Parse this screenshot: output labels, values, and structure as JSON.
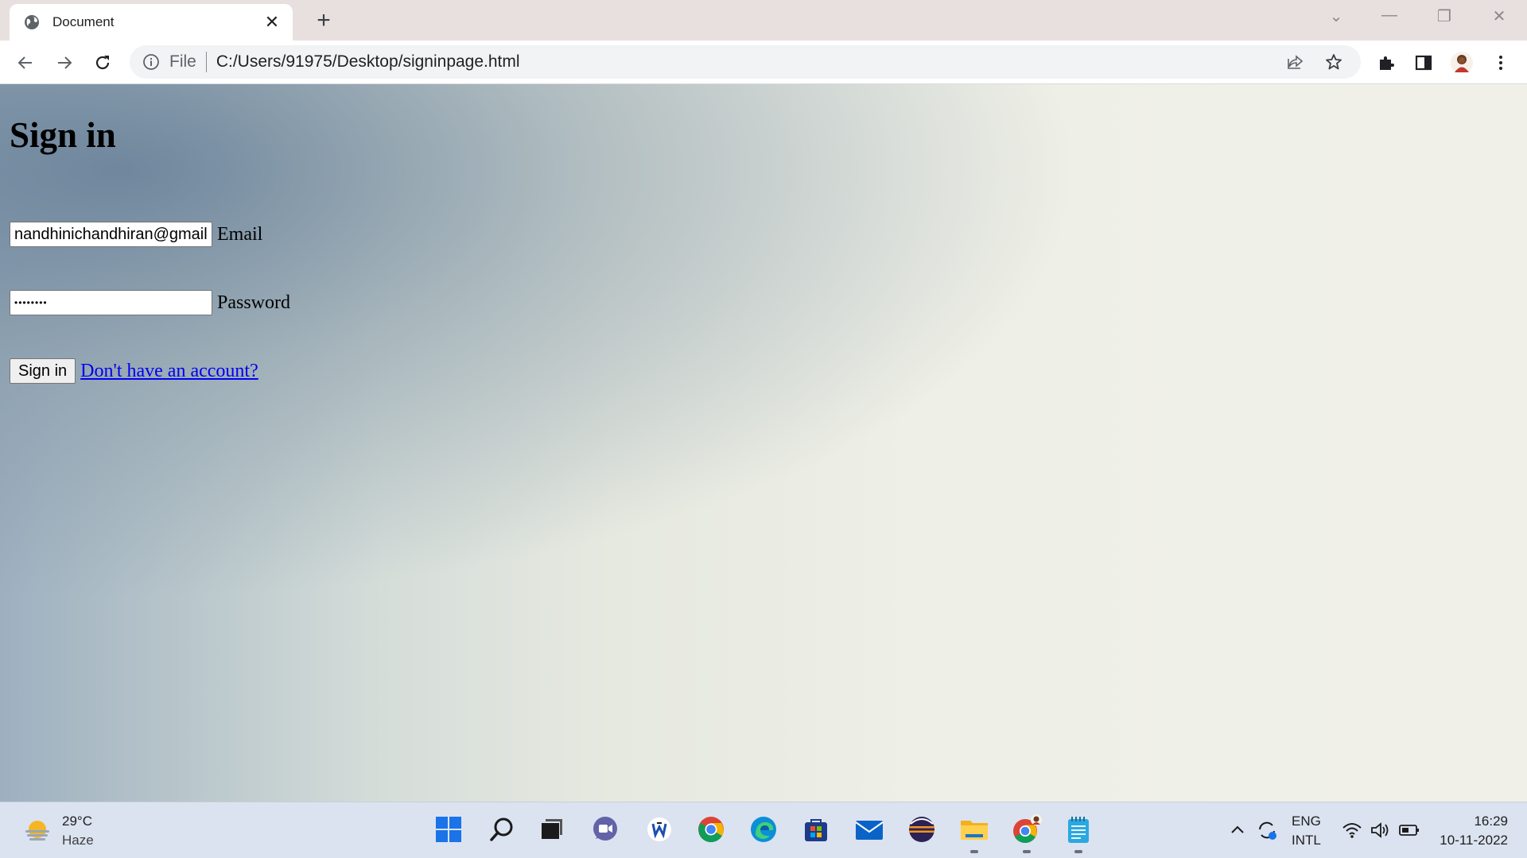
{
  "browser": {
    "tab_title": "Document",
    "tab_close": "✕",
    "new_tab": "+",
    "window_controls": {
      "dropdown": "⌄",
      "minimize": "—",
      "restore": "❐",
      "close": "✕"
    },
    "address": {
      "scheme": "File",
      "url": "C:/Users/91975/Desktop/signinpage.html"
    },
    "icons": [
      "back-icon",
      "forward-icon",
      "reload-icon",
      "info-icon",
      "share-icon",
      "star-icon",
      "extensions-icon",
      "sidepanel-icon",
      "profile-avatar",
      "menu-icon"
    ]
  },
  "page": {
    "heading": "Sign in",
    "email": {
      "value": "nandhinichandhiran@gmail",
      "label": "Email"
    },
    "password": {
      "value": "••••••••",
      "label": "Password"
    },
    "submit_label": "Sign in",
    "signup_link": "Don't have an account?"
  },
  "taskbar": {
    "weather": {
      "temp": "29°C",
      "condition": "Haze"
    },
    "apps": [
      "start-icon",
      "search-icon",
      "task-view-icon",
      "teams-chat-icon",
      "word-icon",
      "chrome-icon",
      "edge-icon",
      "store-icon",
      "mail-icon",
      "eclipse-icon",
      "file-explorer-icon",
      "chrome-profile-icon",
      "notepad-icon"
    ],
    "tray": {
      "lang_top": "ENG",
      "lang_bottom": "INTL"
    },
    "clock": {
      "time": "16:29",
      "date": "10-11-2022"
    }
  },
  "colors": {
    "tabstrip": "#e8e0df",
    "link": "#0000ee",
    "taskbar": "#dbe3f0"
  }
}
